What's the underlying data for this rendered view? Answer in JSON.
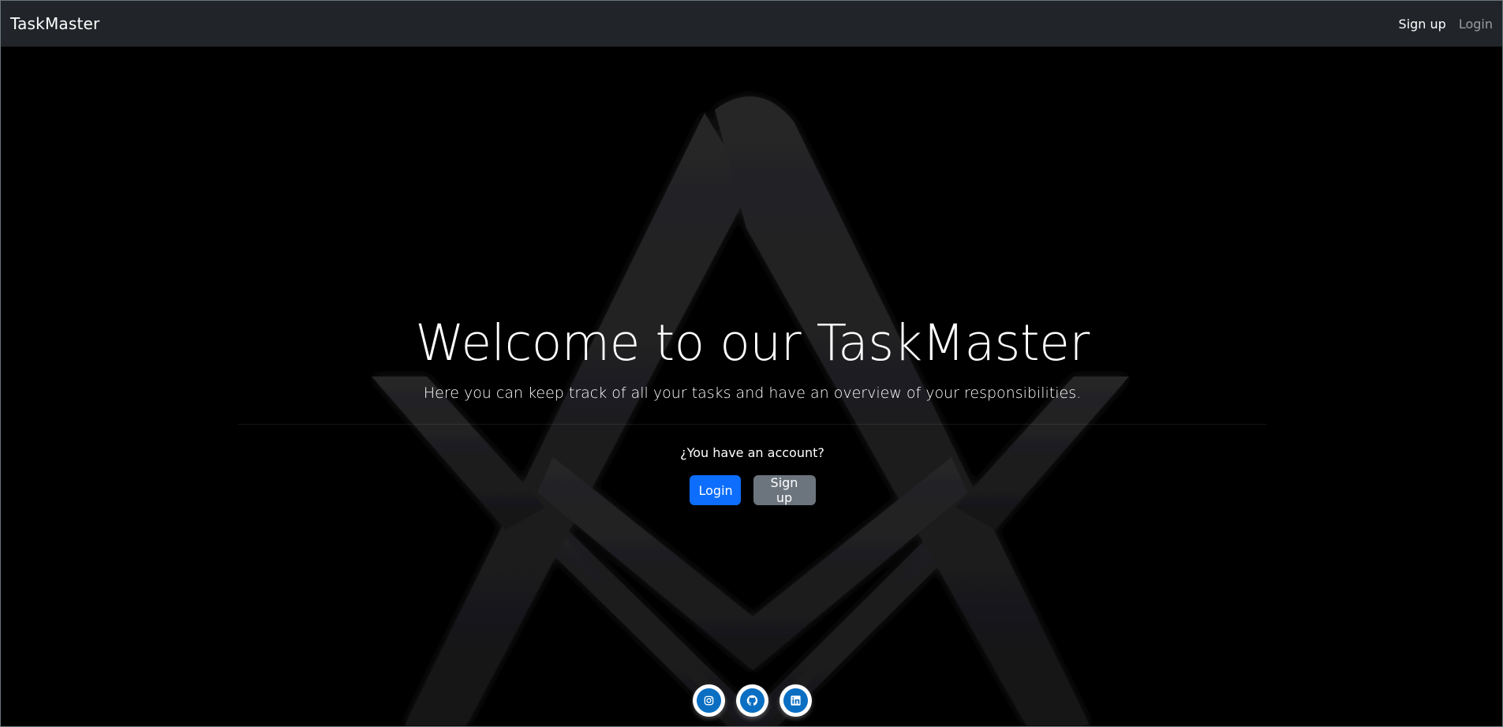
{
  "navbar": {
    "brand": "TaskMaster",
    "links": [
      {
        "label": "Sign up",
        "active": true
      },
      {
        "label": "Login",
        "active": false
      }
    ]
  },
  "hero": {
    "title": "Welcome to our TaskMaster",
    "subtitle": "Here you can keep track of all your tasks and have an overview of your responsibilities.",
    "account_question": "¿You have an account?",
    "login_button": "Login",
    "signup_button": "Sign up"
  },
  "social": [
    {
      "icon": "instagram-icon"
    },
    {
      "icon": "github-icon"
    },
    {
      "icon": "linkedin-icon"
    }
  ],
  "colors": {
    "navbar_bg": "#212529",
    "page_bg": "#000000",
    "primary": "#0d6efd",
    "secondary": "#6c757d",
    "social_blue": "#0a6fc2",
    "emblem": "#1c1c1e"
  }
}
